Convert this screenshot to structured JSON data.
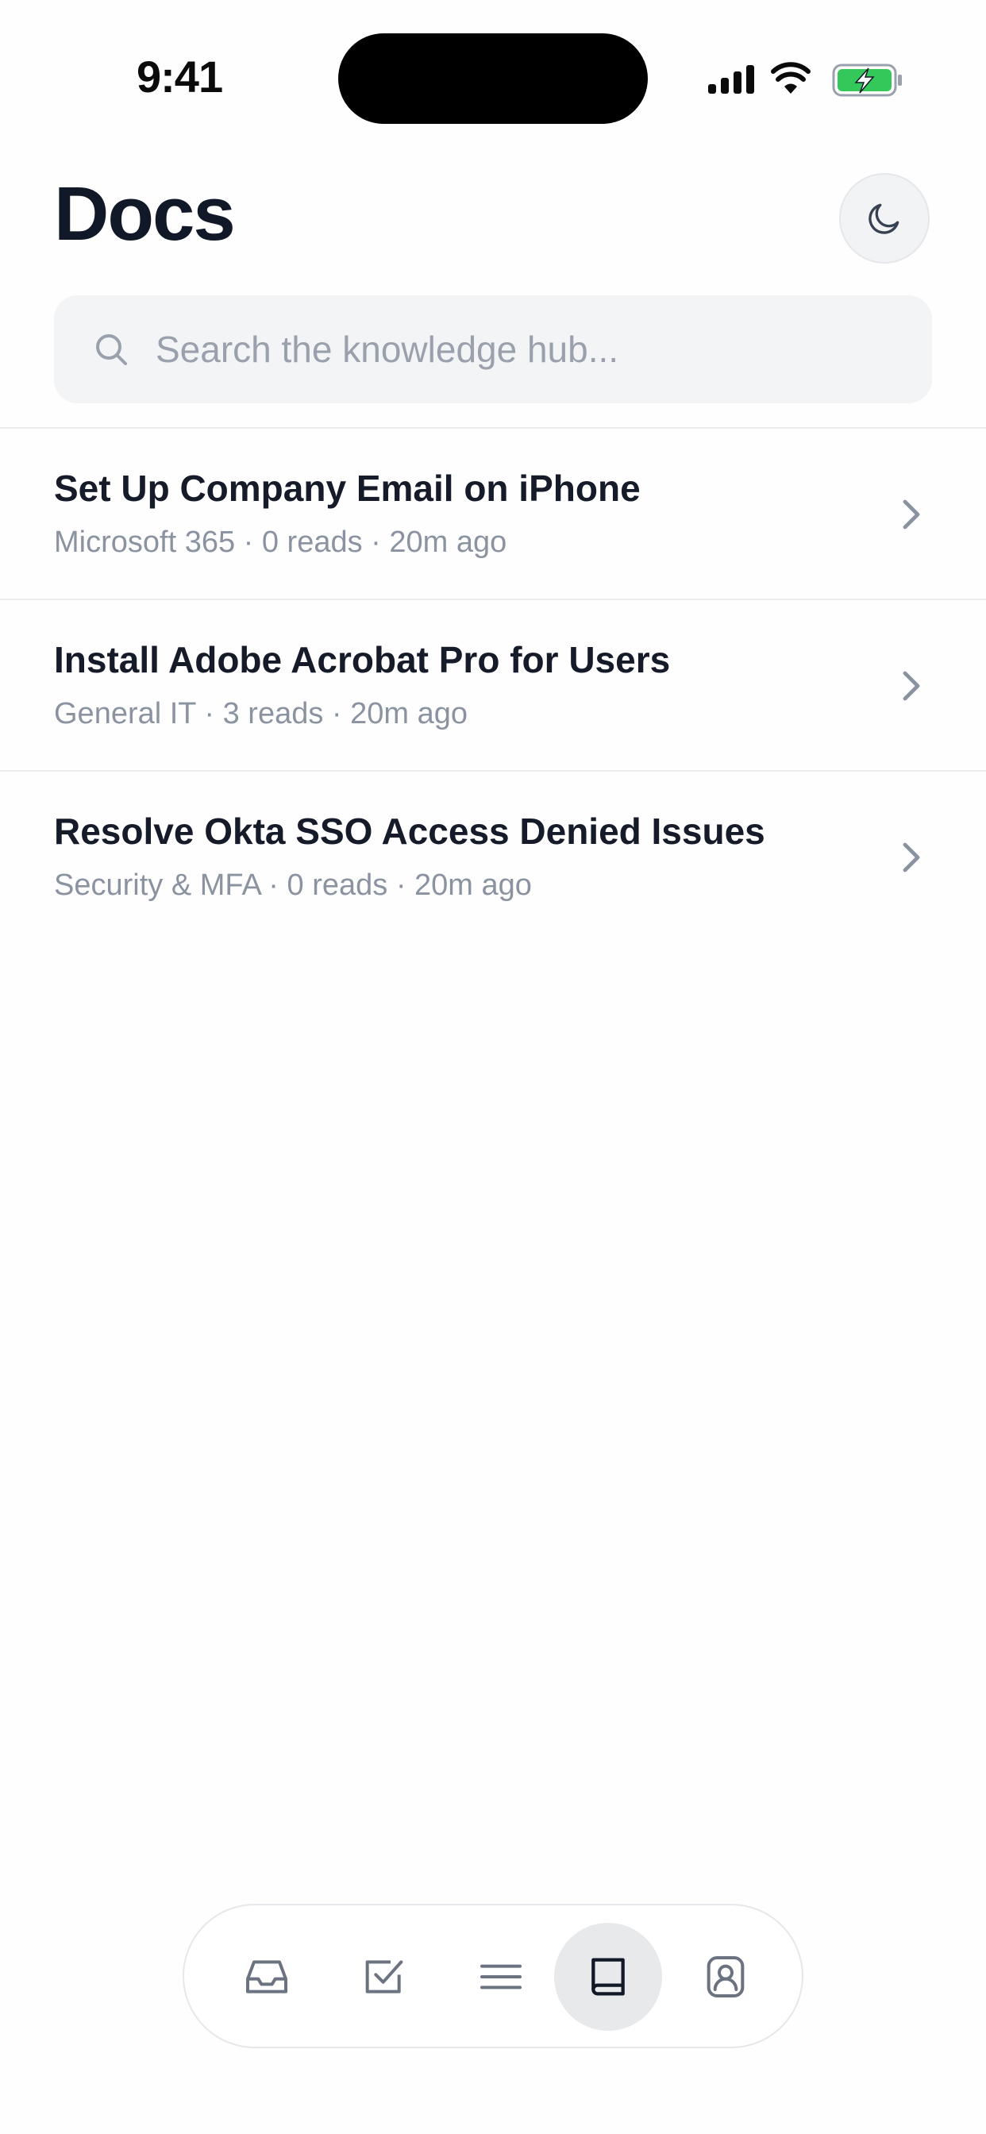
{
  "status_bar": {
    "time": "9:41"
  },
  "header": {
    "title": "Docs",
    "theme_toggle_icon": "moon-icon"
  },
  "search": {
    "placeholder": "Search the knowledge hub...",
    "value": ""
  },
  "docs": [
    {
      "title": "Set Up Company Email on iPhone",
      "meta": "Microsoft 365 · 0 reads · 20m ago"
    },
    {
      "title": "Install Adobe Acrobat Pro for Users",
      "meta": "General IT · 3 reads · 20m ago"
    },
    {
      "title": "Resolve Okta SSO Access Denied Issues",
      "meta": "Security & MFA · 0 reads · 20m ago"
    }
  ],
  "bottom_nav": {
    "items": [
      {
        "icon": "inbox-icon",
        "active": false
      },
      {
        "icon": "checkbox-icon",
        "active": false
      },
      {
        "icon": "menu-icon",
        "active": false
      },
      {
        "icon": "book-icon",
        "active": true
      },
      {
        "icon": "contact-icon",
        "active": false
      }
    ]
  },
  "colors": {
    "battery_green": "#34c759",
    "active_nav_bg": "#e8e9eb",
    "meta_text": "#8b93a1"
  }
}
